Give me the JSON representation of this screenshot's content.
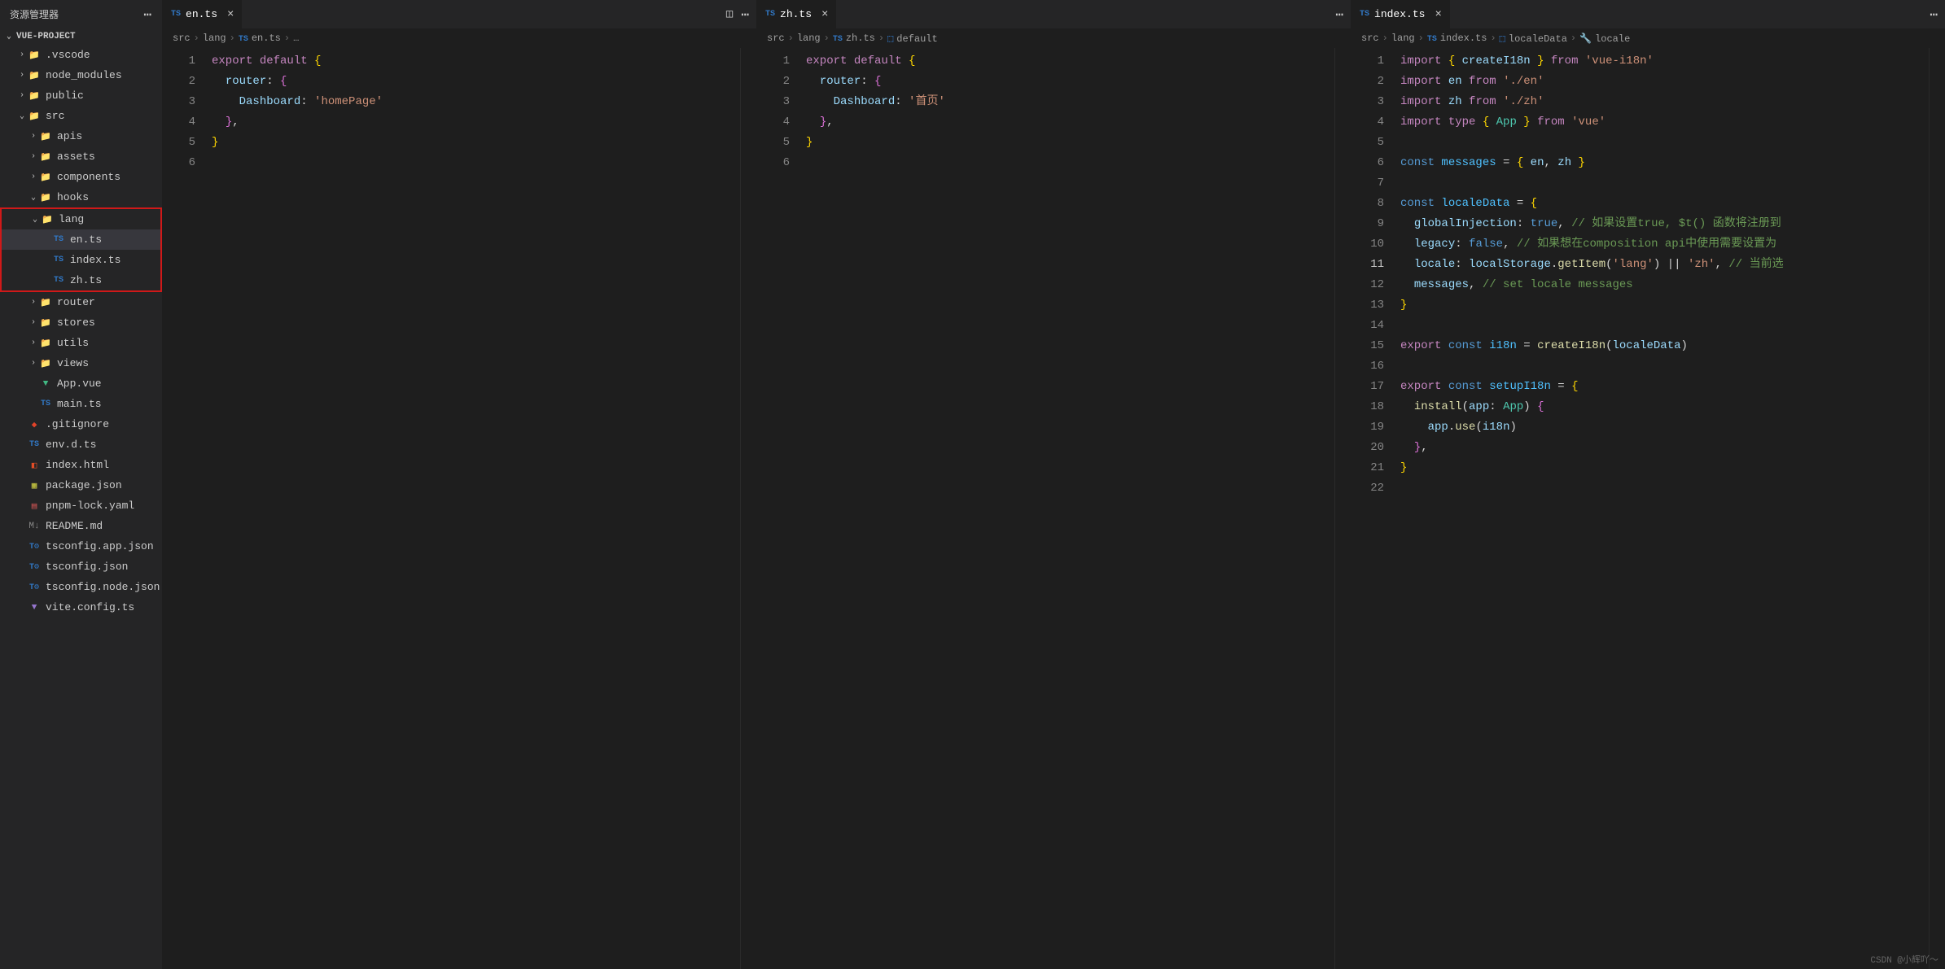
{
  "sidebar": {
    "title": "资源管理器",
    "project": "VUE-PROJECT",
    "tree": [
      {
        "type": "folder",
        "name": ".vscode",
        "indent": 1,
        "open": false,
        "icon": "folder"
      },
      {
        "type": "folder",
        "name": "node_modules",
        "indent": 1,
        "open": false,
        "icon": "folder"
      },
      {
        "type": "folder",
        "name": "public",
        "indent": 1,
        "open": false,
        "icon": "folder"
      },
      {
        "type": "folder",
        "name": "src",
        "indent": 1,
        "open": true,
        "icon": "folder-src"
      },
      {
        "type": "folder",
        "name": "apis",
        "indent": 2,
        "open": false,
        "icon": "folder"
      },
      {
        "type": "folder",
        "name": "assets",
        "indent": 2,
        "open": false,
        "icon": "folder"
      },
      {
        "type": "folder",
        "name": "components",
        "indent": 2,
        "open": false,
        "icon": "folder"
      },
      {
        "type": "folder",
        "name": "hooks",
        "indent": 2,
        "open": true,
        "icon": "folder"
      },
      {
        "type": "folder",
        "name": "lang",
        "indent": 2,
        "open": true,
        "icon": "folder",
        "hl": true
      },
      {
        "type": "file",
        "name": "en.ts",
        "indent": 3,
        "icon": "ts",
        "hl": true,
        "selected": true
      },
      {
        "type": "file",
        "name": "index.ts",
        "indent": 3,
        "icon": "ts",
        "hl": true
      },
      {
        "type": "file",
        "name": "zh.ts",
        "indent": 3,
        "icon": "ts",
        "hl": true
      },
      {
        "type": "folder",
        "name": "router",
        "indent": 2,
        "open": false,
        "icon": "folder"
      },
      {
        "type": "folder",
        "name": "stores",
        "indent": 2,
        "open": false,
        "icon": "folder"
      },
      {
        "type": "folder",
        "name": "utils",
        "indent": 2,
        "open": false,
        "icon": "folder"
      },
      {
        "type": "folder",
        "name": "views",
        "indent": 2,
        "open": false,
        "icon": "folder"
      },
      {
        "type": "file",
        "name": "App.vue",
        "indent": 2,
        "icon": "vue"
      },
      {
        "type": "file",
        "name": "main.ts",
        "indent": 2,
        "icon": "ts"
      },
      {
        "type": "file",
        "name": ".gitignore",
        "indent": 1,
        "icon": "git"
      },
      {
        "type": "file",
        "name": "env.d.ts",
        "indent": 1,
        "icon": "ts"
      },
      {
        "type": "file",
        "name": "index.html",
        "indent": 1,
        "icon": "html"
      },
      {
        "type": "file",
        "name": "package.json",
        "indent": 1,
        "icon": "json"
      },
      {
        "type": "file",
        "name": "pnpm-lock.yaml",
        "indent": 1,
        "icon": "yaml"
      },
      {
        "type": "file",
        "name": "README.md",
        "indent": 1,
        "icon": "md"
      },
      {
        "type": "file",
        "name": "tsconfig.app.json",
        "indent": 1,
        "icon": "tsconf"
      },
      {
        "type": "file",
        "name": "tsconfig.json",
        "indent": 1,
        "icon": "tsconf"
      },
      {
        "type": "file",
        "name": "tsconfig.node.json",
        "indent": 1,
        "icon": "tsconf"
      },
      {
        "type": "file",
        "name": "vite.config.ts",
        "indent": 1,
        "icon": "vite"
      }
    ]
  },
  "panes": [
    {
      "tab": {
        "label": "en.ts",
        "icon": "TS"
      },
      "breadcrumbs": [
        "src",
        "lang",
        "en.ts",
        "…"
      ],
      "ts_crumb_idx": 2,
      "lines": 6,
      "code_tokens": [
        [
          {
            "t": "export",
            "c": "kw"
          },
          {
            "t": " "
          },
          {
            "t": "default",
            "c": "kw"
          },
          {
            "t": " "
          },
          {
            "t": "{",
            "c": "brace"
          }
        ],
        [
          {
            "t": "  "
          },
          {
            "t": "router",
            "c": "prop"
          },
          {
            "t": ": "
          },
          {
            "t": "{",
            "c": "brace2"
          }
        ],
        [
          {
            "t": "    "
          },
          {
            "t": "Dashboard",
            "c": "prop"
          },
          {
            "t": ": "
          },
          {
            "t": "'homePage'",
            "c": "str"
          }
        ],
        [
          {
            "t": "  "
          },
          {
            "t": "}",
            "c": "brace2"
          },
          {
            "t": ","
          }
        ],
        [
          {
            "t": "}",
            "c": "brace"
          }
        ],
        []
      ],
      "show_split": true
    },
    {
      "tab": {
        "label": "zh.ts",
        "icon": "TS"
      },
      "breadcrumbs": [
        "src",
        "lang",
        "zh.ts",
        "default"
      ],
      "ts_crumb_idx": 2,
      "symbol_crumb_idx": 3,
      "lines": 6,
      "code_tokens": [
        [
          {
            "t": "export",
            "c": "kw"
          },
          {
            "t": " "
          },
          {
            "t": "default",
            "c": "kw"
          },
          {
            "t": " "
          },
          {
            "t": "{",
            "c": "brace"
          }
        ],
        [
          {
            "t": "  "
          },
          {
            "t": "router",
            "c": "prop"
          },
          {
            "t": ": "
          },
          {
            "t": "{",
            "c": "brace2"
          }
        ],
        [
          {
            "t": "    "
          },
          {
            "t": "Dashboard",
            "c": "prop"
          },
          {
            "t": ": "
          },
          {
            "t": "'首页'",
            "c": "str"
          }
        ],
        [
          {
            "t": "  "
          },
          {
            "t": "}",
            "c": "brace2"
          },
          {
            "t": ","
          }
        ],
        [
          {
            "t": "}",
            "c": "brace"
          }
        ],
        []
      ]
    },
    {
      "tab": {
        "label": "index.ts",
        "icon": "TS"
      },
      "breadcrumbs": [
        "src",
        "lang",
        "index.ts",
        "localeData",
        "locale"
      ],
      "ts_crumb_idx": 2,
      "symbol_crumb_idx": 3,
      "wrench_crumb_idx": 4,
      "lines": 22,
      "current_line": 11,
      "code_tokens": [
        [
          {
            "t": "import",
            "c": "kw"
          },
          {
            "t": " "
          },
          {
            "t": "{",
            "c": "brace"
          },
          {
            "t": " "
          },
          {
            "t": "createI18n",
            "c": "prop"
          },
          {
            "t": " "
          },
          {
            "t": "}",
            "c": "brace"
          },
          {
            "t": " "
          },
          {
            "t": "from",
            "c": "kw"
          },
          {
            "t": " "
          },
          {
            "t": "'vue-i18n'",
            "c": "str"
          }
        ],
        [
          {
            "t": "import",
            "c": "kw"
          },
          {
            "t": " "
          },
          {
            "t": "en",
            "c": "prop"
          },
          {
            "t": " "
          },
          {
            "t": "from",
            "c": "kw"
          },
          {
            "t": " "
          },
          {
            "t": "'./en'",
            "c": "str"
          }
        ],
        [
          {
            "t": "import",
            "c": "kw"
          },
          {
            "t": " "
          },
          {
            "t": "zh",
            "c": "prop"
          },
          {
            "t": " "
          },
          {
            "t": "from",
            "c": "kw"
          },
          {
            "t": " "
          },
          {
            "t": "'./zh'",
            "c": "str"
          }
        ],
        [
          {
            "t": "import",
            "c": "kw"
          },
          {
            "t": " "
          },
          {
            "t": "type",
            "c": "kw"
          },
          {
            "t": " "
          },
          {
            "t": "{",
            "c": "brace"
          },
          {
            "t": " "
          },
          {
            "t": "App",
            "c": "cls"
          },
          {
            "t": " "
          },
          {
            "t": "}",
            "c": "brace"
          },
          {
            "t": " "
          },
          {
            "t": "from",
            "c": "kw"
          },
          {
            "t": " "
          },
          {
            "t": "'vue'",
            "c": "str"
          }
        ],
        [],
        [
          {
            "t": "const",
            "c": "kw2"
          },
          {
            "t": " "
          },
          {
            "t": "messages",
            "c": "var"
          },
          {
            "t": " = "
          },
          {
            "t": "{",
            "c": "brace"
          },
          {
            "t": " "
          },
          {
            "t": "en",
            "c": "prop"
          },
          {
            "t": ", "
          },
          {
            "t": "zh",
            "c": "prop"
          },
          {
            "t": " "
          },
          {
            "t": "}",
            "c": "brace"
          }
        ],
        [],
        [
          {
            "t": "const",
            "c": "kw2"
          },
          {
            "t": " "
          },
          {
            "t": "localeData",
            "c": "var"
          },
          {
            "t": " = "
          },
          {
            "t": "{",
            "c": "brace"
          }
        ],
        [
          {
            "t": "  "
          },
          {
            "t": "globalInjection",
            "c": "prop"
          },
          {
            "t": ": "
          },
          {
            "t": "true",
            "c": "kw2"
          },
          {
            "t": ", "
          },
          {
            "t": "// 如果设置true, $t() 函数将注册到",
            "c": "cmt"
          }
        ],
        [
          {
            "t": "  "
          },
          {
            "t": "legacy",
            "c": "prop"
          },
          {
            "t": ": "
          },
          {
            "t": "false",
            "c": "kw2"
          },
          {
            "t": ", "
          },
          {
            "t": "// 如果想在composition api中使用需要设置为",
            "c": "cmt"
          }
        ],
        [
          {
            "t": "  "
          },
          {
            "t": "locale",
            "c": "prop"
          },
          {
            "t": ": "
          },
          {
            "t": "localStorage",
            "c": "prop"
          },
          {
            "t": "."
          },
          {
            "t": "getItem",
            "c": "fn"
          },
          {
            "t": "("
          },
          {
            "t": "'lang'",
            "c": "str"
          },
          {
            "t": ") || "
          },
          {
            "t": "'zh'",
            "c": "str"
          },
          {
            "t": ", "
          },
          {
            "t": "// 当前选",
            "c": "cmt"
          }
        ],
        [
          {
            "t": "  "
          },
          {
            "t": "messages",
            "c": "prop"
          },
          {
            "t": ", "
          },
          {
            "t": "// set locale messages",
            "c": "cmt"
          }
        ],
        [
          {
            "t": "}",
            "c": "brace"
          }
        ],
        [],
        [
          {
            "t": "export",
            "c": "kw"
          },
          {
            "t": " "
          },
          {
            "t": "const",
            "c": "kw2"
          },
          {
            "t": " "
          },
          {
            "t": "i18n",
            "c": "var"
          },
          {
            "t": " = "
          },
          {
            "t": "createI18n",
            "c": "fn"
          },
          {
            "t": "("
          },
          {
            "t": "localeData",
            "c": "prop"
          },
          {
            "t": ")"
          }
        ],
        [],
        [
          {
            "t": "export",
            "c": "kw"
          },
          {
            "t": " "
          },
          {
            "t": "const",
            "c": "kw2"
          },
          {
            "t": " "
          },
          {
            "t": "setupI18n",
            "c": "var"
          },
          {
            "t": " = "
          },
          {
            "t": "{",
            "c": "brace"
          }
        ],
        [
          {
            "t": "  "
          },
          {
            "t": "install",
            "c": "fn"
          },
          {
            "t": "("
          },
          {
            "t": "app",
            "c": "prop"
          },
          {
            "t": ": "
          },
          {
            "t": "App",
            "c": "cls"
          },
          {
            "t": ") "
          },
          {
            "t": "{",
            "c": "brace2"
          }
        ],
        [
          {
            "t": "    "
          },
          {
            "t": "app",
            "c": "prop"
          },
          {
            "t": "."
          },
          {
            "t": "use",
            "c": "fn"
          },
          {
            "t": "("
          },
          {
            "t": "i18n",
            "c": "prop"
          },
          {
            "t": ")"
          }
        ],
        [
          {
            "t": "  "
          },
          {
            "t": "}",
            "c": "brace2"
          },
          {
            "t": ","
          }
        ],
        [
          {
            "t": "}",
            "c": "brace"
          }
        ],
        []
      ],
      "bracket_bar": [
        9,
        10,
        11,
        12,
        13
      ]
    }
  ],
  "watermark": "CSDN @小辉吖～"
}
